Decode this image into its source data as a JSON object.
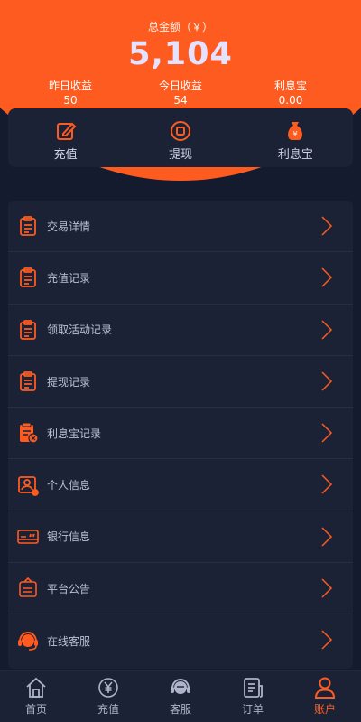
{
  "summary": {
    "total_label": "总金额（￥）",
    "total_value": "5,104",
    "stats": [
      {
        "label": "昨日收益",
        "value": "50"
      },
      {
        "label": "今日收益",
        "value": "54"
      },
      {
        "label": "利息宝",
        "value": "0.00"
      }
    ]
  },
  "quick_actions": [
    {
      "label": "充值",
      "icon": "recharge-icon"
    },
    {
      "label": "提现",
      "icon": "withdraw-icon"
    },
    {
      "label": "利息宝",
      "icon": "money-bag-icon"
    }
  ],
  "menu": [
    {
      "label": "交易详情",
      "icon": "clipboard-icon"
    },
    {
      "label": "充值记录",
      "icon": "clipboard-icon"
    },
    {
      "label": "领取活动记录",
      "icon": "clipboard-icon"
    },
    {
      "label": "提现记录",
      "icon": "clipboard-icon"
    },
    {
      "label": "利息宝记录",
      "icon": "clipboard-coin-icon"
    },
    {
      "label": "个人信息",
      "icon": "user-card-icon"
    },
    {
      "label": "银行信息",
      "icon": "bank-card-icon"
    },
    {
      "label": "平台公告",
      "icon": "announcement-icon"
    },
    {
      "label": "在线客服",
      "icon": "headset-icon"
    }
  ],
  "tabbar": [
    {
      "label": "首页",
      "icon": "home-icon"
    },
    {
      "label": "充值",
      "icon": "yen-coin-icon"
    },
    {
      "label": "客服",
      "icon": "headset-icon"
    },
    {
      "label": "订单",
      "icon": "document-icon"
    },
    {
      "label": "账户",
      "icon": "user-icon",
      "active": true
    }
  ],
  "colors": {
    "accent": "#fe5b20",
    "background": "#151b2e",
    "card": "#1b2236"
  }
}
